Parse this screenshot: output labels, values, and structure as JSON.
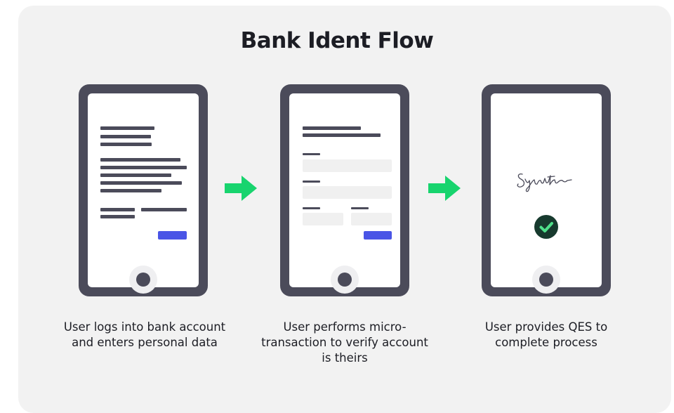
{
  "title": "Bank Ident Flow",
  "steps": [
    {
      "caption": "User logs into bank account and enters personal data"
    },
    {
      "caption": "User performs micro-transaction to verify account is theirs"
    },
    {
      "caption": "User provides QES to complete process"
    }
  ],
  "colors": {
    "background": "#f2f2f2",
    "phone": "#4b4b5a",
    "arrow": "#18d46e",
    "button": "#4a55e6",
    "check_bg": "#173a2e",
    "check_mark": "#4fe08a"
  },
  "icons": [
    "arrow-right-icon",
    "signature-icon",
    "check-circle-icon",
    "home-button-icon"
  ]
}
